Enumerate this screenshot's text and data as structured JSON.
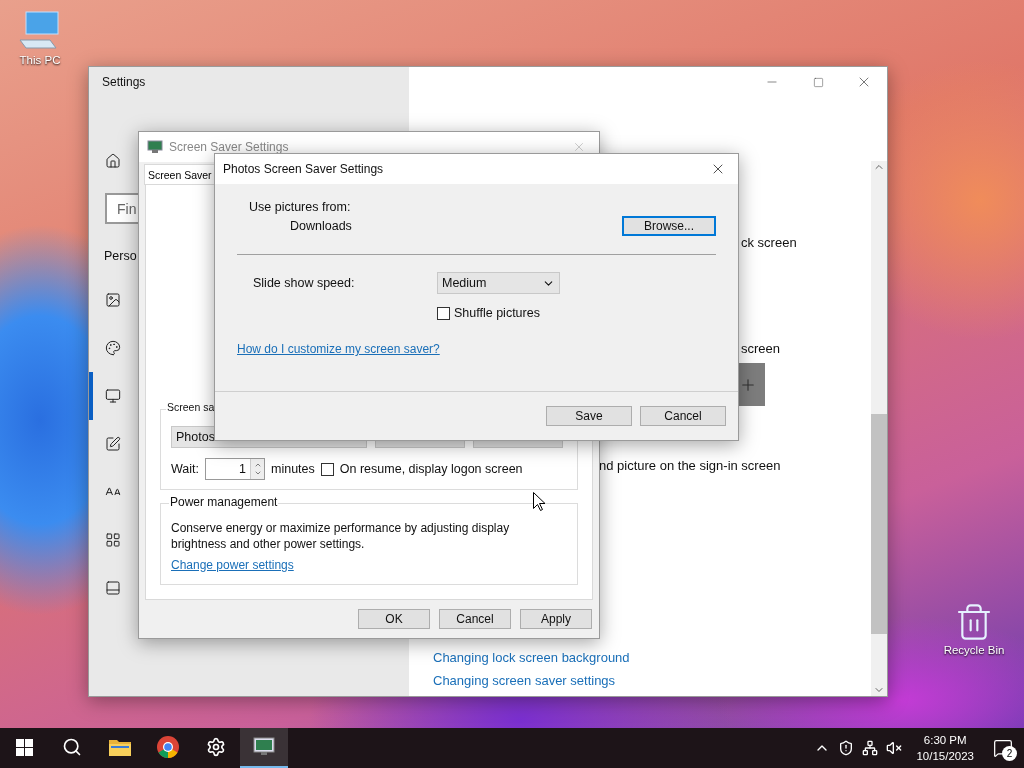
{
  "desktop_icons": [
    {
      "kind": "computer",
      "label": "This PC"
    },
    {
      "kind": "recycle",
      "label": "Recycle Bin"
    }
  ],
  "settings_window": {
    "title": "Settings",
    "search": {
      "placeholder": "Fin"
    },
    "section_heading": "Perso",
    "nav_items": [
      {
        "kind": "home",
        "selected": false
      },
      {
        "kind": "picture",
        "selected": false
      },
      {
        "kind": "palette",
        "selected": false
      },
      {
        "kind": "display",
        "selected": true
      },
      {
        "kind": "pen",
        "selected": false
      },
      {
        "kind": "font",
        "selected": false
      },
      {
        "kind": "grid",
        "selected": false
      },
      {
        "kind": "taskbar",
        "selected": false
      }
    ],
    "content_fragments": [
      {
        "kind": "text",
        "text": "ck screen"
      },
      {
        "kind": "text",
        "text": "screen"
      },
      {
        "kind": "plus"
      },
      {
        "kind": "text",
        "text": "nd picture on the sign-in screen"
      }
    ],
    "links": [
      "Changing lock screen background",
      "Changing screen saver settings"
    ]
  },
  "screen_saver_window": {
    "title": "Screen Saver Settings",
    "tabs": [
      {
        "label": "Screen Saver",
        "selected": true
      }
    ],
    "group_label": "Screen sa",
    "saver_value": "Photos",
    "wait_label": "Wait:",
    "wait_value": "1",
    "minutes_label": "minutes",
    "logon_checkbox": {
      "label": "On resume, display logon screen",
      "checked": false
    },
    "power_group": {
      "title": "Power management",
      "text": "Conserve energy or maximize performance by adjusting display brightness and other power settings.",
      "link": "Change power settings"
    },
    "buttons": [
      "OK",
      "Cancel",
      "Apply"
    ]
  },
  "photos_dialog": {
    "title": "Photos Screen Saver Settings",
    "use_pictures_label": "Use pictures from:",
    "folder": "Downloads",
    "browse_button": "Browse...",
    "speed_label": "Slide show speed:",
    "speed_value": "Medium",
    "shuffle_checkbox": {
      "label": "Shuffle pictures",
      "checked": false
    },
    "help_link": "How do I customize my screen saver?",
    "buttons": [
      "Save",
      "Cancel"
    ]
  },
  "taskbar": {
    "apps": [
      {
        "kind": "start",
        "selected": false
      },
      {
        "kind": "search",
        "selected": false
      },
      {
        "kind": "folder",
        "selected": false
      },
      {
        "kind": "browser",
        "selected": false
      },
      {
        "kind": "gear",
        "selected": false
      },
      {
        "kind": "screensaver",
        "selected": true
      }
    ],
    "time": "6:30 PM",
    "date": "10/15/2023",
    "notification_count": "2"
  }
}
